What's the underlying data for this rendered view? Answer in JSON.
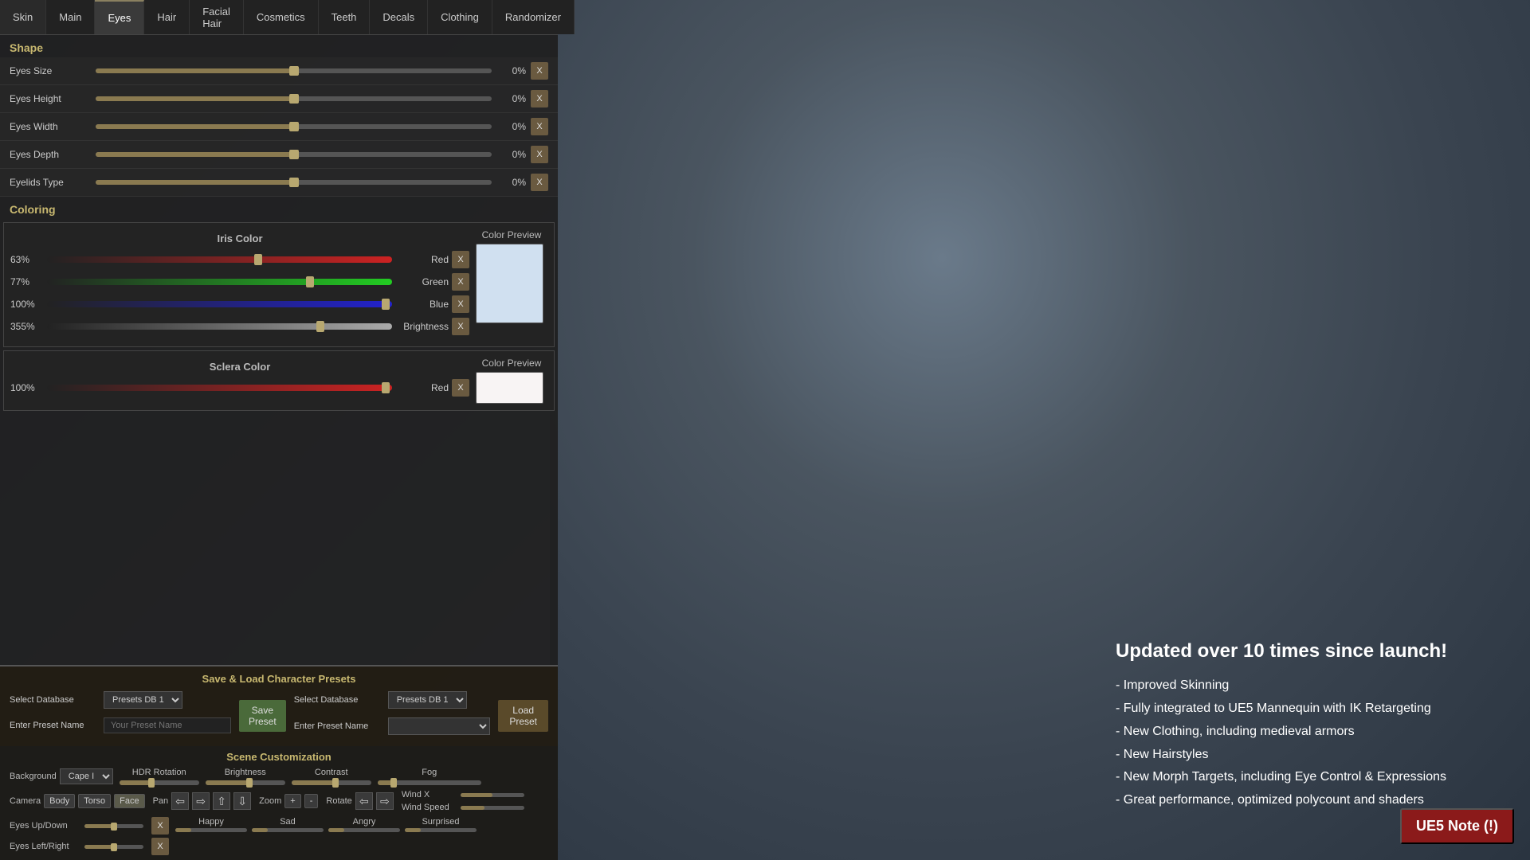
{
  "tabs": [
    {
      "id": "skin",
      "label": "Skin",
      "active": false
    },
    {
      "id": "main",
      "label": "Main",
      "active": false
    },
    {
      "id": "eyes",
      "label": "Eyes",
      "active": true
    },
    {
      "id": "hair",
      "label": "Hair",
      "active": false
    },
    {
      "id": "facial_hair",
      "label": "Facial Hair",
      "active": false
    },
    {
      "id": "cosmetics",
      "label": "Cosmetics",
      "active": false
    },
    {
      "id": "teeth",
      "label": "Teeth",
      "active": false
    },
    {
      "id": "decals",
      "label": "Decals",
      "active": false
    },
    {
      "id": "clothing",
      "label": "Clothing",
      "active": false
    },
    {
      "id": "randomizer",
      "label": "Randomizer",
      "active": false
    }
  ],
  "shape_section": {
    "label": "Shape",
    "sliders": [
      {
        "label": "Eyes Size",
        "value": "0%",
        "fill_pct": 50
      },
      {
        "label": "Eyes Height",
        "value": "0%",
        "fill_pct": 50
      },
      {
        "label": "Eyes Width",
        "value": "0%",
        "fill_pct": 50
      },
      {
        "label": "Eyes Depth",
        "value": "0%",
        "fill_pct": 50
      },
      {
        "label": "Eyelids Type",
        "value": "0%",
        "fill_pct": 50
      }
    ]
  },
  "coloring_section": {
    "label": "Coloring",
    "iris_color": {
      "title": "Iris Color",
      "preview_title": "Color Preview",
      "preview_color": "#d0e0f0",
      "channels": [
        {
          "pct": "63%",
          "color_class": "color-track-red",
          "name": "Red",
          "fill_pct": 63
        },
        {
          "pct": "77%",
          "color_class": "color-track-green",
          "name": "Green",
          "fill_pct": 77
        },
        {
          "pct": "100%",
          "color_class": "color-track-blue",
          "name": "Blue",
          "fill_pct": 100
        },
        {
          "pct": "355%",
          "color_class": "color-track-gray",
          "name": "Brightness",
          "fill_pct": 80
        }
      ]
    },
    "sclera_color": {
      "title": "Sclera Color",
      "preview_title": "Color Preview",
      "preview_color": "#f8f4f4",
      "channels": [
        {
          "pct": "100%",
          "color_class": "color-track-red",
          "name": "Red",
          "fill_pct": 100
        }
      ]
    }
  },
  "presets": {
    "title": "Save & Load Character Presets",
    "save_db_label": "Select Database",
    "save_db_value": "Presets DB 1",
    "save_name_label": "Enter Preset Name",
    "save_name_placeholder": "Your Preset Name",
    "save_btn_label": "Save\nPreset",
    "load_db_label": "Select Database",
    "load_db_value": "Presets DB 1",
    "load_name_label": "Enter Preset Name",
    "load_btn_label": "Load\nPreset"
  },
  "scene": {
    "title": "Scene Customization",
    "background_label": "Background",
    "background_value": "Cape I",
    "hdr_label": "HDR Rotation",
    "brightness_label": "Brightness",
    "contrast_label": "Contrast",
    "fog_label": "Fog",
    "camera_label": "Camera",
    "cam_body": "Body",
    "cam_torso": "Torso",
    "cam_face": "Face",
    "pan_label": "Pan",
    "zoom_label": "Zoom",
    "rotate_label": "Rotate",
    "wind_x_label": "Wind X",
    "wind_speed_label": "Wind Speed",
    "eyes_up_down": "Eyes Up/Down",
    "eyes_left_right": "Eyes Left/Right",
    "happy_label": "Happy",
    "sad_label": "Sad",
    "angry_label": "Angry",
    "surprised_label": "Surprised"
  },
  "info": {
    "title": "Updated over 10 times since launch!",
    "points": [
      "- Improved Skinning",
      "- Fully integrated to UE5 Mannequin with IK Retargeting",
      "- New Clothing, including medieval armors",
      "- New Hairstyles",
      "- New Morph Targets, including Eye Control & Expressions",
      "- Great performance, optimized polycount and shaders"
    ],
    "ue5_note": "UE5 Note (!)"
  }
}
